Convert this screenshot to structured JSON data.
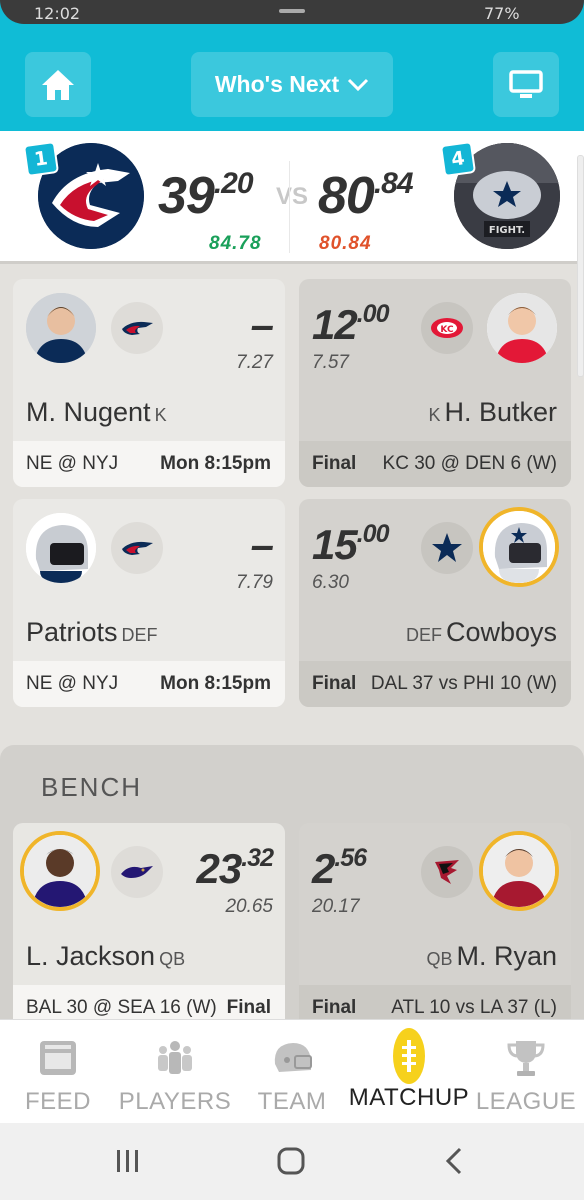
{
  "status": {
    "time": "12:02",
    "battery": "77%"
  },
  "header": {
    "menu_label": "Who's Next",
    "home_icon": "home-icon",
    "screen_icon": "monitor-icon"
  },
  "scoreboard": {
    "left": {
      "rank": "1",
      "score_int": "39",
      "score_dec": ".20",
      "projected": "84.78",
      "projected_color": "#1aa05a"
    },
    "vs": "VS",
    "right": {
      "rank": "4",
      "score_int": "80",
      "score_dec": ".84",
      "projected": "80.84",
      "projected_color": "#e0522b"
    }
  },
  "starters": [
    {
      "left": {
        "pts_int": "–",
        "pts_dec": "",
        "proj": "7.27",
        "name": "M. Nugent",
        "pos": "K",
        "foot_a": "NE @ NYJ",
        "foot_b": "Mon 8:15pm"
      },
      "right": {
        "pts_int": "12",
        "pts_dec": ".00",
        "proj": "7.57",
        "name": "H. Butker",
        "pos": "K",
        "foot_a": "Final",
        "foot_b": "KC 30 @ DEN 6 (W)"
      }
    },
    {
      "left": {
        "pts_int": "–",
        "pts_dec": "",
        "proj": "7.79",
        "name": "Patriots",
        "pos": "DEF",
        "foot_a": "NE @ NYJ",
        "foot_b": "Mon 8:15pm"
      },
      "right": {
        "pts_int": "15",
        "pts_dec": ".00",
        "proj": "6.30",
        "name": "Cowboys",
        "pos": "DEF",
        "foot_a": "Final",
        "foot_b": "DAL 37 vs PHI 10 (W)"
      }
    }
  ],
  "bench": {
    "title": "BENCH",
    "rows": [
      {
        "left": {
          "pts_int": "23",
          "pts_dec": ".32",
          "proj": "20.65",
          "name": "L. Jackson",
          "pos": "QB",
          "foot_a": "BAL 30 @ SEA 16 (W)",
          "foot_b": "Final"
        },
        "right": {
          "pts_int": "2",
          "pts_dec": ".56",
          "proj": "20.17",
          "name": "M. Ryan",
          "pos": "QB",
          "foot_a": "Final",
          "foot_b": "ATL 10 vs LA 37 (L)"
        }
      }
    ]
  },
  "tabs": [
    {
      "label": "FEED",
      "icon": "feed-icon"
    },
    {
      "label": "PLAYERS",
      "icon": "players-icon"
    },
    {
      "label": "TEAM",
      "icon": "helmet-icon"
    },
    {
      "label": "MATCHUP",
      "icon": "football-icon"
    },
    {
      "label": "LEAGUE",
      "icon": "trophy-icon"
    }
  ]
}
